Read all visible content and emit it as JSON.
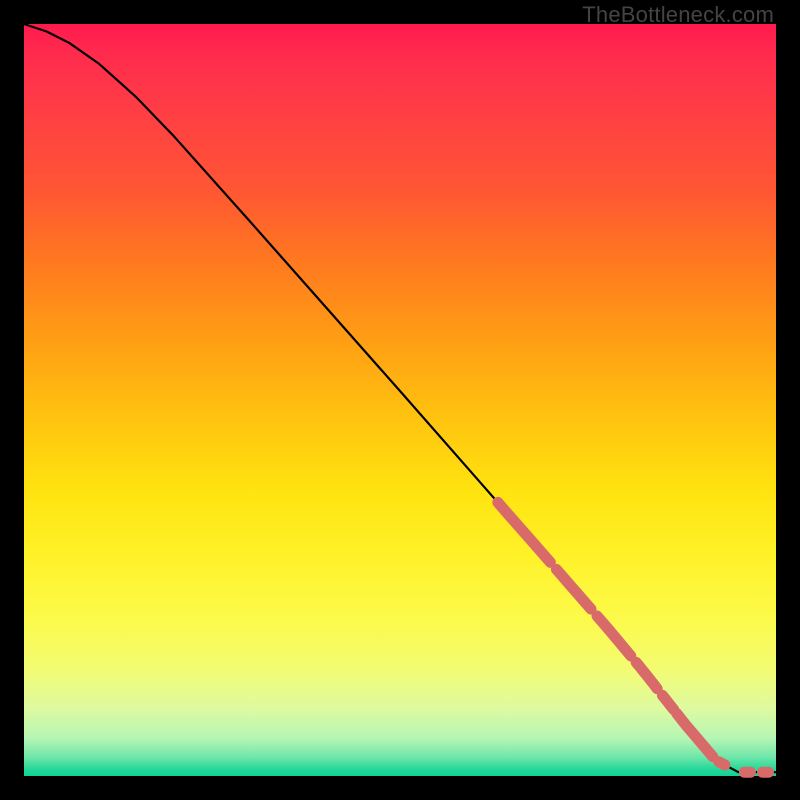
{
  "watermark": "TheBottleneck.com",
  "colors": {
    "frame": "#000000",
    "line": "#000000",
    "highlight": "#d86b69"
  },
  "chart_data": {
    "type": "line",
    "title": "",
    "xlabel": "",
    "ylabel": "",
    "xlim": [
      0,
      100
    ],
    "ylim": [
      0,
      100
    ],
    "grid": false,
    "legend": false,
    "series": [
      {
        "name": "curve",
        "x": [
          0,
          3,
          6,
          10,
          15,
          20,
          30,
          40,
          50,
          60,
          70,
          78,
          82,
          85,
          88,
          92,
          95,
          100
        ],
        "y": [
          100,
          99,
          97.5,
          94.7,
          90.2,
          85,
          73.8,
          62.5,
          51.2,
          39.8,
          28.4,
          19.2,
          14.4,
          10.6,
          6.8,
          2.1,
          0.5,
          0.5
        ]
      }
    ],
    "highlights": {
      "ribbon_segments_x": [
        [
          63,
          70
        ],
        [
          70.8,
          75.4
        ],
        [
          76.2,
          80.7
        ],
        [
          81.4,
          84.2
        ],
        [
          84.9,
          86.4
        ],
        [
          86.8,
          87.8
        ]
      ],
      "baseline_dashes_x": [
        [
          88,
          91.6
        ],
        [
          92.4,
          93.2
        ],
        [
          95.8,
          96.6
        ],
        [
          98.2,
          99.0
        ]
      ]
    }
  }
}
